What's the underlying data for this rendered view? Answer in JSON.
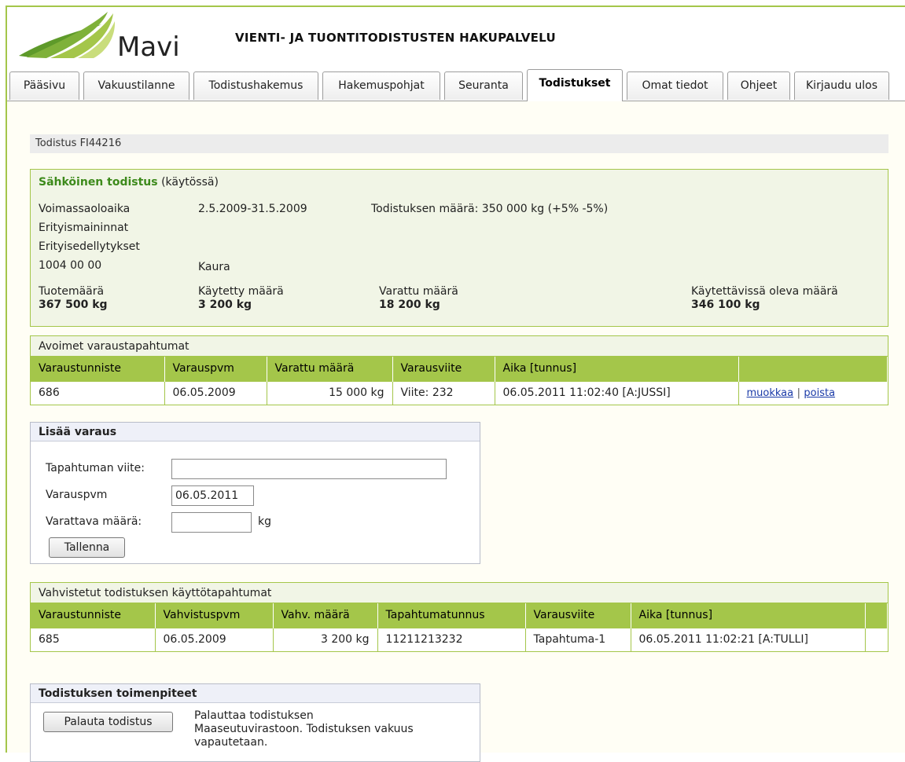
{
  "header": {
    "logo_text": "Mavi",
    "app_title": "VIENTI- JA TUONTITODISTUSTEN HAKUPALVELU"
  },
  "tabs": [
    {
      "label": "Pääsivu"
    },
    {
      "label": "Vakuustilanne"
    },
    {
      "label": "Todistushakemus"
    },
    {
      "label": "Hakemuspohjat"
    },
    {
      "label": "Seuranta"
    },
    {
      "label": "Todistukset",
      "active": true
    },
    {
      "label": "Omat tiedot"
    },
    {
      "label": "Ohjeet"
    },
    {
      "label": "Kirjaudu ulos"
    }
  ],
  "breadcrumb": "Todistus FI44216",
  "certificate": {
    "title": "Sähköinen todistus",
    "status": "(käytössä)",
    "validity_label": "Voimassaoloaika",
    "validity_value": "2.5.2009-31.5.2009",
    "amount_text": "Todistuksen määrä: 350 000 kg (+5% -5%)",
    "special_mentions_label": "Erityismaininnat",
    "special_conditions_label": "Erityisedellytykset",
    "product_code": "1004 00 00",
    "product_name": "Kaura",
    "totals": [
      {
        "label": "Tuotemäärä",
        "value": "367 500 kg"
      },
      {
        "label": "Käytetty määrä",
        "value": "3 200 kg"
      },
      {
        "label": "Varattu määrä",
        "value": "18 200 kg"
      },
      {
        "label": "Käytettävissä oleva määrä",
        "value": "346 100 kg"
      }
    ]
  },
  "open_reservations": {
    "title": "Avoimet varaustapahtumat",
    "columns": [
      "Varaustunniste",
      "Varauspvm",
      "Varattu määrä",
      "Varausviite",
      "Aika [tunnus]",
      ""
    ],
    "rows": [
      {
        "id": "686",
        "date": "06.05.2009",
        "amount": "15 000 kg",
        "ref": "Viite: 232",
        "time": "06.05.2011 11:02:40 [A:JUSSI]",
        "edit": "muokkaa",
        "sep": "|",
        "delete": "poista"
      }
    ]
  },
  "add_reservation": {
    "title": "Lisää varaus",
    "ref_label": "Tapahtuman viite:",
    "ref_value": "",
    "date_label": "Varauspvm",
    "date_value": "06.05.2011",
    "amount_label": "Varattava määrä:",
    "amount_value": "",
    "amount_unit": "kg",
    "save_label": "Tallenna"
  },
  "confirmed_events": {
    "title": "Vahvistetut todistuksen käyttötapahtumat",
    "columns": [
      "Varaustunniste",
      "Vahvistuspvm",
      "Vahv. määrä",
      "Tapahtumatunnus",
      "Varausviite",
      "Aika [tunnus]",
      ""
    ],
    "rows": [
      {
        "id": "685",
        "date": "06.05.2009",
        "amount": "3 200 kg",
        "event_id": "11211213232",
        "ref": "Tapahtuma-1",
        "time": "06.05.2011 11:02:21 [A:TULLI]"
      }
    ]
  },
  "actions": {
    "title": "Todistuksen toimenpiteet",
    "return_button": "Palauta todistus",
    "return_desc_1": "Palauttaa todistuksen",
    "return_desc_2": "Maaseutuvirastoon. Todistuksen vakuus",
    "return_desc_3": "vapautetaan."
  },
  "colors": {
    "accent_green": "#a4c64a",
    "title_green": "#3d8a1b",
    "panel_bg": "#f1f5e6"
  }
}
